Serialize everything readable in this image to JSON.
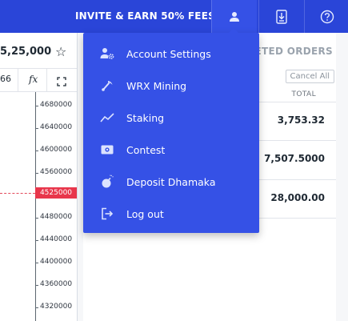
{
  "topbar": {
    "invite_label": "INVITE & EARN 50% FEES",
    "icons": [
      "user-icon",
      "download-icon",
      "help-icon"
    ]
  },
  "chart": {
    "price": "5,25,000",
    "toolbar_value": "66",
    "fx_label": "𝑓x",
    "axis_labels": [
      "4680000",
      "4640000",
      "4600000",
      "4560000",
      "4480000",
      "4440000",
      "4400000",
      "4360000",
      "4320000"
    ],
    "current_price": "4525000",
    "colors": {
      "current": "#e8364b"
    }
  },
  "orders": {
    "header": "LETED ORDERS",
    "cancel_all": "Cancel All",
    "col_total": "TOTAL",
    "rows": [
      {
        "total": "3,753.32",
        "bar_color": "#3dbf5a"
      },
      {
        "total": "7,507.5000",
        "bar_color": "#3dbf5a"
      },
      {
        "total": "28,000.00",
        "bar_color": "#e8364b"
      }
    ]
  },
  "menu": {
    "items": [
      {
        "label": "Account Settings",
        "icon": "user-settings-icon"
      },
      {
        "label": "WRX Mining",
        "icon": "mining-pick-icon"
      },
      {
        "label": "Staking",
        "icon": "trend-line-icon"
      },
      {
        "label": "Contest",
        "icon": "ticket-icon"
      },
      {
        "label": "Deposit Dhamaka",
        "icon": "bomb-icon"
      },
      {
        "label": "Log out",
        "icon": "logout-icon"
      }
    ]
  },
  "colors": {
    "brand": "#2a45d8",
    "menu_bg": "#3551e6",
    "positive": "#3dbf5a",
    "negative": "#e8364b"
  }
}
